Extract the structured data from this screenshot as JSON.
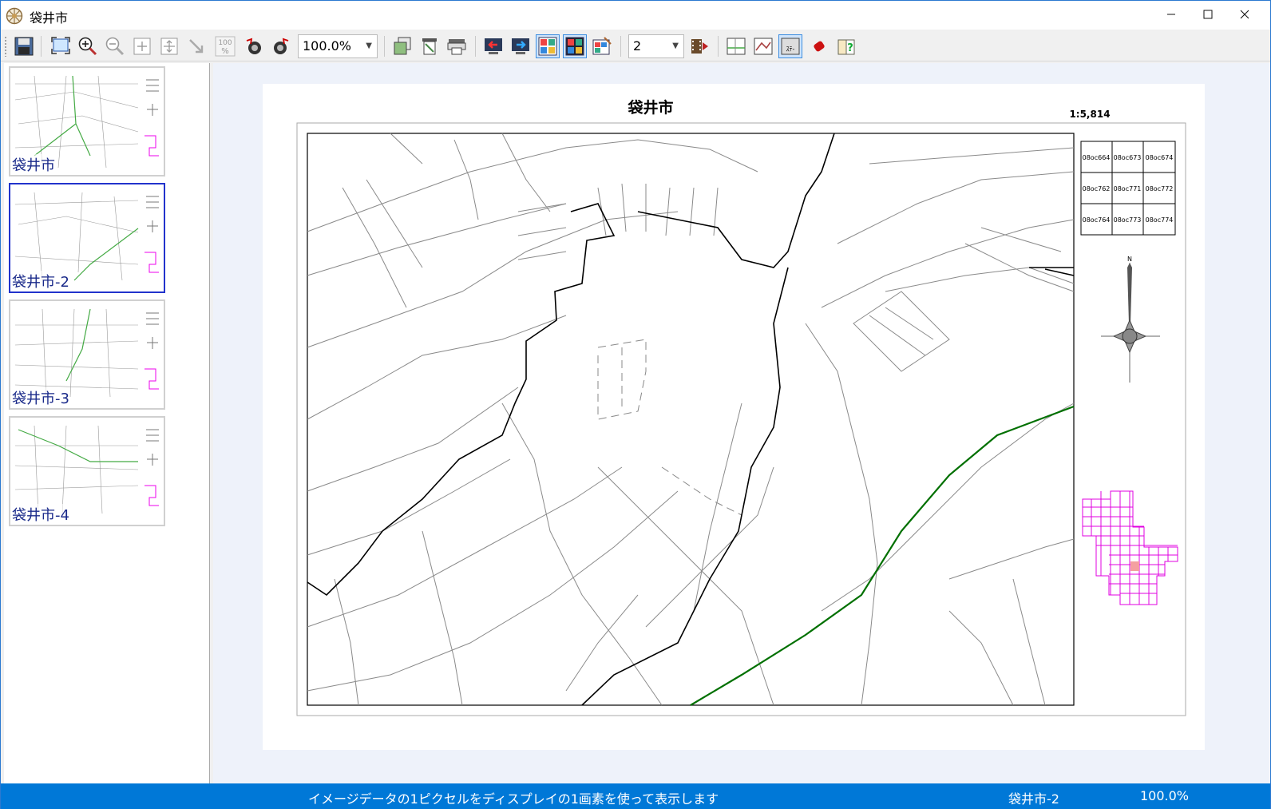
{
  "window": {
    "title": "袋井市"
  },
  "toolbar": {
    "zoom_value": "100.0%",
    "page_value": "2"
  },
  "sidebar": {
    "thumbnails": [
      {
        "label": "袋井市"
      },
      {
        "label": "袋井市-2"
      },
      {
        "label": "袋井市-3"
      },
      {
        "label": "袋井市-4"
      }
    ]
  },
  "map": {
    "title": "袋井市",
    "scale": "1:5,814",
    "index_grid": [
      [
        "08oc664",
        "08oc673",
        "08oc674"
      ],
      [
        "08oc762",
        "08oc771",
        "08oc772"
      ],
      [
        "08oc764",
        "08oc773",
        "08oc774"
      ]
    ],
    "north_label": "N",
    "road_color": "#007000",
    "key_map_color": "#e000e0"
  },
  "status": {
    "message": "イメージデータの1ピクセルをディスプレイの1画素を使って表示します",
    "sheet": "袋井市-2",
    "zoom": "100.0%"
  }
}
